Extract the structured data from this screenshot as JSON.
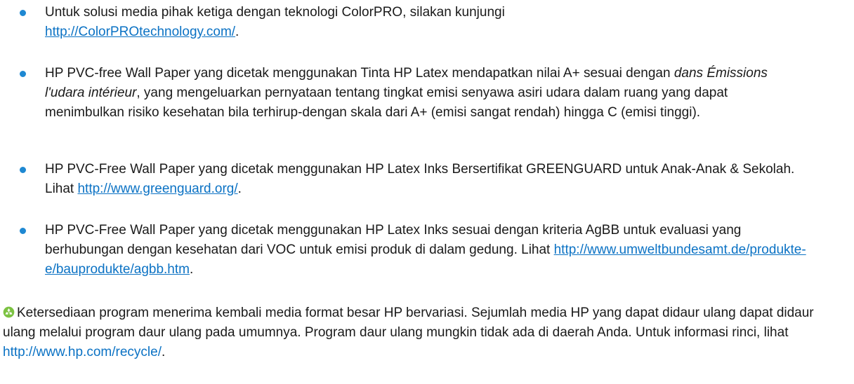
{
  "bullets": [
    {
      "pre": "Untuk solusi media pihak ketiga dengan teknologi ColorPRO, silakan kunjungi",
      "link": "http://ColorPROtechnology.com/",
      "post": "."
    },
    {
      "pre": "HP PVC-free Wall Paper yang dicetak menggunakan Tinta HP Latex mendapatkan nilai A+ sesuai dengan",
      "em": "dans Émissions l'udara intérieur",
      "post": ", yang mengeluarkan pernyataan tentang tingkat emisi senyawa asiri udara dalam ruang yang dapat menimbulkan risiko kesehatan bila terhirup-dengan skala dari A+ (emisi sangat rendah) hingga C (emisi tinggi)."
    },
    {
      "pre": "HP PVC-Free Wall Paper yang dicetak menggunakan HP Latex Inks Bersertifikat GREENGUARD untuk Anak-Anak & Sekolah. Lihat",
      "link": "http://www.greenguard.org/",
      "post": "."
    },
    {
      "pre": "HP PVC-Free Wall Paper yang dicetak menggunakan HP Latex Inks sesuai dengan kriteria AgBB untuk evaluasi yang berhubungan dengan kesehatan dari VOC untuk emisi produk di dalam gedung. Lihat",
      "link": "http://www.umweltbundesamt.de/produkte-e/bauprodukte/agbb.htm",
      "post": "."
    }
  ],
  "recycle": {
    "icon": "recycle-icon",
    "pre": "Ketersediaan program menerima kembali media format besar HP bervariasi. Sejumlah media HP yang dapat didaur ulang dapat didaur ulang melalui program daur ulang pada umumnya. Program daur ulang mungkin tidak ada di daerah Anda. Untuk informasi rinci, lihat",
    "link": "http://www.hp.com/recycle/",
    "post": "."
  },
  "colors": {
    "bullet": "#1e88d2",
    "link": "#0b72c4",
    "icon": "#7cc242"
  }
}
